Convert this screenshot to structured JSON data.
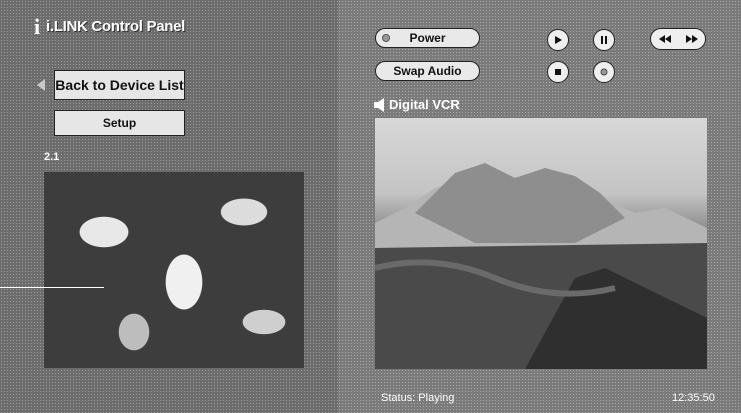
{
  "app": {
    "title": "i.LINK Control Panel"
  },
  "sidebar": {
    "back_label": "Back to Device List",
    "setup_label": "Setup",
    "channel_label": "2.1"
  },
  "controls": {
    "power_label": "Power",
    "swap_audio_label": "Swap Audio"
  },
  "device": {
    "name": "Digital VCR"
  },
  "statusbar": {
    "status": "Status: Playing",
    "time": "12:35:50"
  },
  "icons": [
    "logo-i-icon",
    "back-arrow-icon",
    "power-indicator-icon",
    "play-icon",
    "pause-icon",
    "stop-icon",
    "record-icon",
    "rewind-icon",
    "fast-forward-icon",
    "speaker-icon"
  ]
}
